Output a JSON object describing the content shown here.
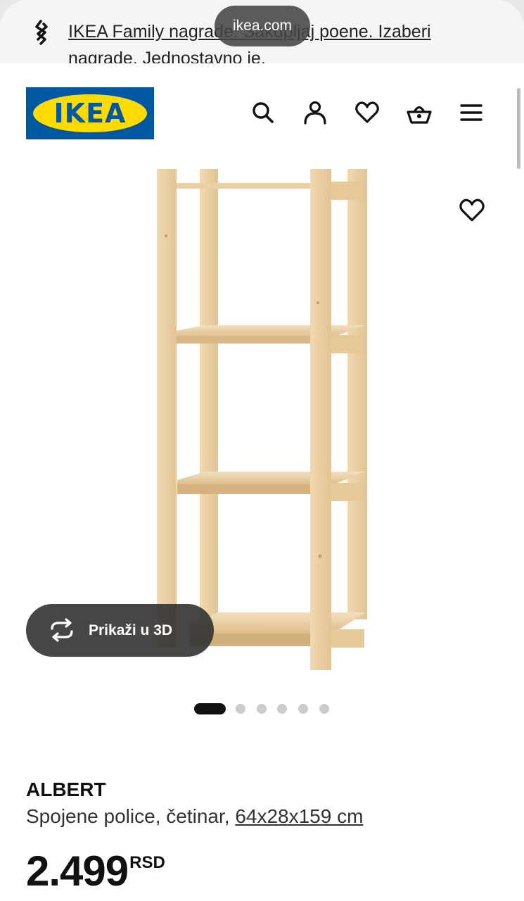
{
  "browser": {
    "url_pill": "ikea.com"
  },
  "banner": {
    "text": "IKEA Family nagrade: Sakupljaj poene. Izaberi nagrade. Jednostavno je."
  },
  "header": {
    "logo_text": "IKEA",
    "icons": [
      "search-icon",
      "user-icon",
      "heart-icon",
      "basket-icon",
      "menu-icon"
    ]
  },
  "gallery": {
    "view_3d_label": "Prikaži u 3D",
    "slide_count": 6,
    "active_slide": 1
  },
  "product": {
    "name": "ALBERT",
    "description": "Spojene police, četinar,",
    "dimensions": "64x28x159 cm",
    "price": "2.499",
    "currency": "RSD"
  },
  "colors": {
    "ikea_blue": "#0058a3",
    "ikea_yellow": "#ffdb00",
    "wood": "#ecd3a8"
  }
}
